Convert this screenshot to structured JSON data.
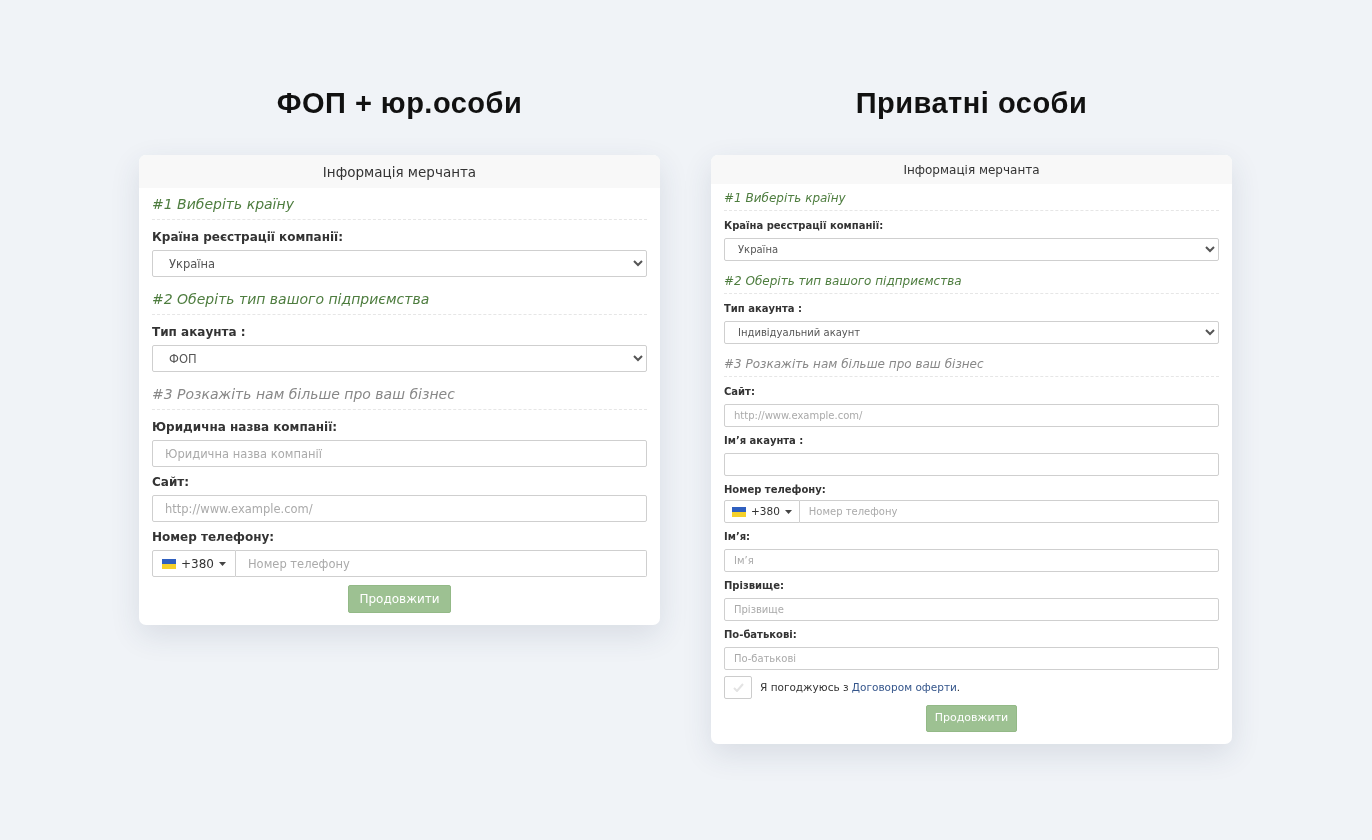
{
  "panels": [
    {
      "heading": "ФОП + юр.особи",
      "card_title": "Інформація мерчанта",
      "items": [
        {
          "kind": "section",
          "text": "#1 Виберіть країну",
          "current": true
        },
        {
          "kind": "select",
          "label": "Країна реєстрації компанії:",
          "value": "Україна"
        },
        {
          "kind": "section",
          "text": "#2 Оберіть тип вашого підприємства",
          "current": true
        },
        {
          "kind": "select",
          "label": "Тип акаунта :",
          "value": "ФОП"
        },
        {
          "kind": "section",
          "text": "#3 Розкажіть нам більше про ваш бізнес",
          "current": false
        },
        {
          "kind": "input",
          "label": "Юридична назва компанії:",
          "placeholder": "Юридична назва компанії"
        },
        {
          "kind": "input",
          "label": "Сайт:",
          "placeholder": "http://www.example.com/"
        },
        {
          "kind": "phone",
          "label": "Номер телефону:",
          "code": "+380",
          "placeholder": "Номер телефону"
        },
        {
          "kind": "button",
          "text": "Продовжити",
          "disabled": true
        }
      ]
    },
    {
      "heading": "Приватні особи",
      "card_title": "Інформація мерчанта",
      "items": [
        {
          "kind": "section",
          "text": "#1 Виберіть країну",
          "current": true
        },
        {
          "kind": "select",
          "label": "Країна реєстрації компанії:",
          "value": "Україна"
        },
        {
          "kind": "section",
          "text": "#2 Оберіть тип вашого підприємства",
          "current": true
        },
        {
          "kind": "select",
          "label": "Тип акаунта :",
          "value": "Індивідуальний акаунт"
        },
        {
          "kind": "section",
          "text": "#3 Розкажіть нам більше про ваш бізнес",
          "current": false
        },
        {
          "kind": "input",
          "label": "Сайт:",
          "placeholder": "http://www.example.com/"
        },
        {
          "kind": "input",
          "label": "Ім’я акаунта :"
        },
        {
          "kind": "phone",
          "label": "Номер телефону:",
          "code": "+380",
          "placeholder": "Номер телефону"
        },
        {
          "kind": "input",
          "label": "Ім’я:",
          "placeholder": "Ім’я"
        },
        {
          "kind": "input",
          "label": "Прізвище:",
          "placeholder": "Прізвище"
        },
        {
          "kind": "input",
          "label": "По-батькові:",
          "placeholder": "По-батькові"
        },
        {
          "kind": "checkbox",
          "checked": false,
          "text_before": "Я погоджуюсь з ",
          "link": "Договором оферти",
          "text_after": "."
        },
        {
          "kind": "button",
          "text": "Продовжити",
          "disabled": true
        }
      ]
    }
  ]
}
